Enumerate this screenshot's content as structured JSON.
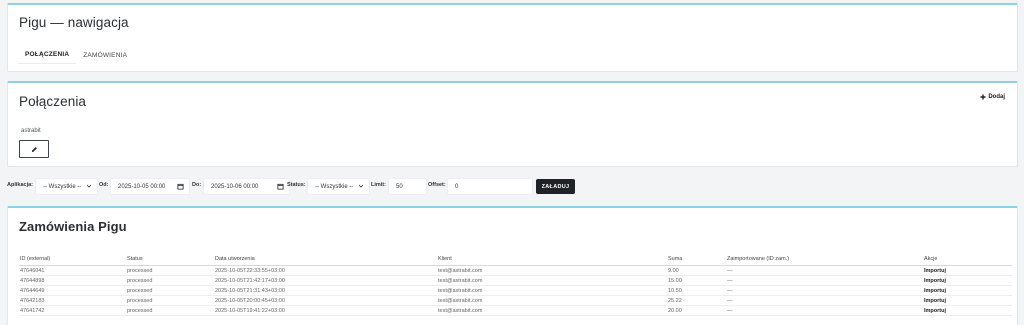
{
  "nav": {
    "title": "Pigu — nawigacja",
    "tabs": [
      {
        "label": "POŁĄCZENIA",
        "active": true
      },
      {
        "label": "ZAMÓWIENIA",
        "active": false
      }
    ]
  },
  "connections": {
    "title": "Połączenia",
    "add_label": "Dodaj",
    "items": [
      {
        "name": "astrabit",
        "edit_icon": "pencil-icon"
      }
    ]
  },
  "filters": {
    "app_label": "Aplikacja:",
    "app_value": "-- Wszystkie --",
    "from_label": "Od:",
    "from_value": "2025-10-05 00:00",
    "to_label": "Do:",
    "to_value": "2025-10-06 00:00",
    "status_label": "Status:",
    "status_value": "-- Wszystkie --",
    "limit_label": "Limit:",
    "limit_value": "50",
    "offset_label": "Offset:",
    "offset_value": "0",
    "load_label": "ZAŁADUJ"
  },
  "orders": {
    "title": "Zamówienia Pigu",
    "columns": [
      "ID (external)",
      "Status",
      "Data utworzenia",
      "Klient",
      "Suma",
      "Zaimportowane (ID zam.)",
      "Akcje"
    ],
    "rows": [
      [
        "47646041",
        "processed",
        "2025-10-05T22:33:55+03:00",
        "test@astrabit.com",
        "9.00",
        "—",
        "Importuj"
      ],
      [
        "47644898",
        "processed",
        "2025-10-05T21:42:17+03:00",
        "test@astrabit.com",
        "15.00",
        "—",
        "Importuj"
      ],
      [
        "47644649",
        "processed",
        "2025-10-05T21:31:43+03:00",
        "test@astrabit.com",
        "10.50",
        "—",
        "Importuj"
      ],
      [
        "47642183",
        "processed",
        "2025-10-05T20:00:45+03:00",
        "test@astrabit.com",
        "25.22",
        "—",
        "Importuj"
      ],
      [
        "47641742",
        "processed",
        "2025-10-05T19:41:22+03:00",
        "test@astrabit.com",
        "20.00",
        "—",
        "Importuj"
      ]
    ]
  }
}
